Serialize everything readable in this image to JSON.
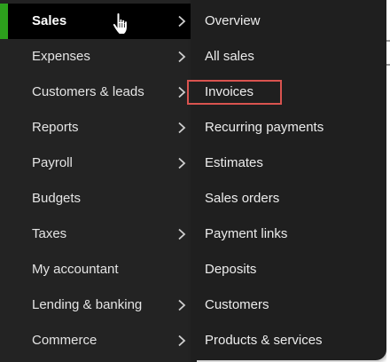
{
  "nav": {
    "items": [
      {
        "label": "Sales",
        "has_submenu": true,
        "active": true
      },
      {
        "label": "Expenses",
        "has_submenu": true
      },
      {
        "label": "Customers & leads",
        "has_submenu": true
      },
      {
        "label": "Reports",
        "has_submenu": true
      },
      {
        "label": "Payroll",
        "has_submenu": true
      },
      {
        "label": "Budgets",
        "has_submenu": false
      },
      {
        "label": "Taxes",
        "has_submenu": true
      },
      {
        "label": "My accountant",
        "has_submenu": false
      },
      {
        "label": "Lending & banking",
        "has_submenu": true
      },
      {
        "label": "Commerce",
        "has_submenu": true
      }
    ]
  },
  "submenu": {
    "items": [
      {
        "label": "Overview"
      },
      {
        "label": "All sales"
      },
      {
        "label": "Invoices",
        "highlighted": true
      },
      {
        "label": "Recurring payments"
      },
      {
        "label": "Estimates"
      },
      {
        "label": "Sales orders"
      },
      {
        "label": "Payment links"
      },
      {
        "label": "Deposits"
      },
      {
        "label": "Customers"
      },
      {
        "label": "Products & services"
      }
    ]
  },
  "colors": {
    "sidebar_bg": "#232323",
    "active_bg": "#000000",
    "active_accent": "#2ca01c",
    "flyout_bg": "#1f1f1f",
    "highlight_border": "#d9534f"
  },
  "icons": {
    "submenu_indicator": "chevron-right-icon",
    "pointer": "hand-cursor-icon"
  }
}
